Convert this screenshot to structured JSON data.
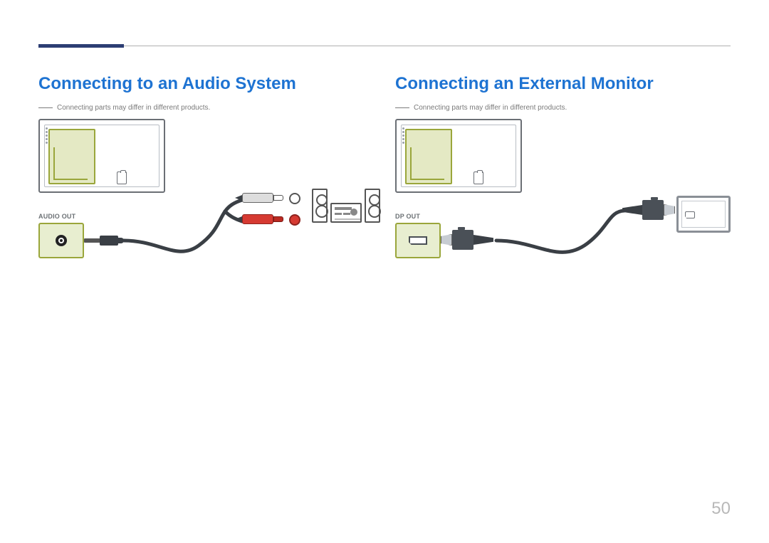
{
  "page_number": "50",
  "sections": {
    "audio": {
      "title": "Connecting to an Audio System",
      "note": "Connecting parts may differ in different products.",
      "port_label": "AUDIO OUT"
    },
    "monitor": {
      "title": "Connecting an External Monitor",
      "note": "Connecting parts may differ in different products.",
      "port_label": "DP OUT"
    }
  }
}
